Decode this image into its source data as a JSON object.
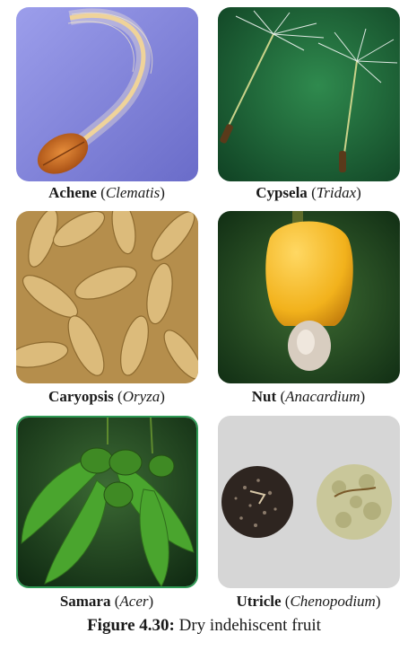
{
  "figure": {
    "label": "Figure 4.30:",
    "title": "Dry indehiscent fruit"
  },
  "panels": [
    {
      "type": "Achene",
      "genus": "Clematis"
    },
    {
      "type": "Cypsela",
      "genus": "Tridax"
    },
    {
      "type": "Caryopsis",
      "genus": "Oryza"
    },
    {
      "type": "Nut",
      "genus": "Anacardium"
    },
    {
      "type": "Samara",
      "genus": "Acer"
    },
    {
      "type": "Utricle",
      "genus": "Chenopodium"
    }
  ],
  "colors": {
    "achene_bg": "#7d7fd6",
    "cypsela_bg": "#1f6a3a",
    "caryopsis_grain": "#d9b777",
    "nut_fruit": "#f2b21c",
    "samara_wing": "#4aa52e",
    "samara_border": "#2f9a55",
    "utricle_bg": "#d6d6d6"
  }
}
